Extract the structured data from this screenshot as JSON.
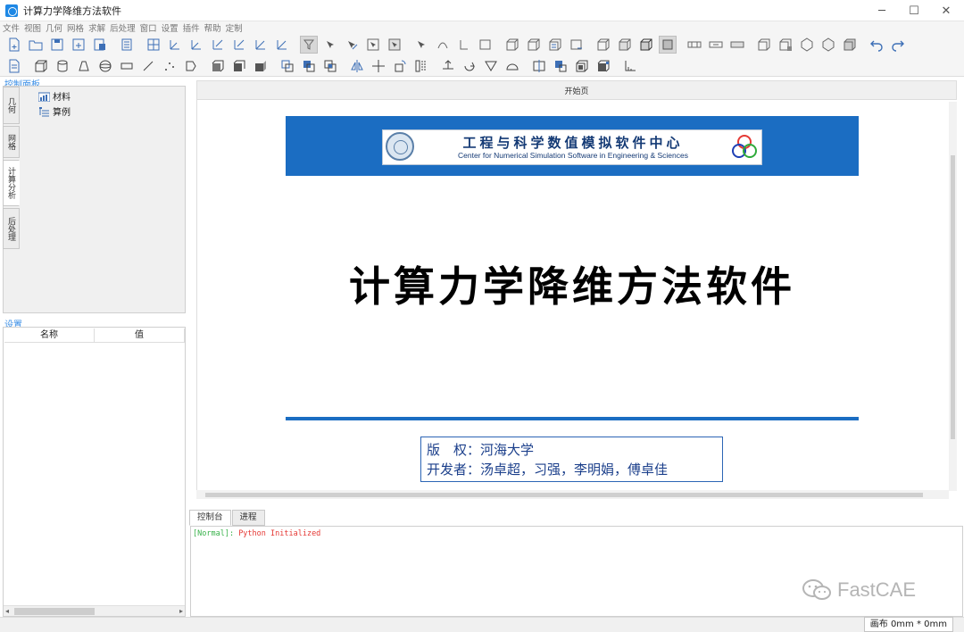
{
  "window": {
    "title": "计算力学降维方法软件",
    "minimize": "─",
    "maximize": "☐",
    "close": "✕"
  },
  "menu": [
    "文件",
    "视图",
    "几何",
    "网格",
    "求解",
    "后处理",
    "窗口",
    "设置",
    "插件",
    "帮助",
    "定制"
  ],
  "control_panel": {
    "label": "控制面板",
    "vertical_tabs": [
      "几何",
      "网格",
      "计算分析",
      "后处理"
    ],
    "active_tab": "计算分析",
    "tree": [
      "材料",
      "算例"
    ]
  },
  "settings": {
    "label": "设置",
    "columns": [
      "名称",
      "值"
    ]
  },
  "central": {
    "tab_label": "开始页",
    "center_name_cn": "工程与科学数值模拟软件中心",
    "center_name_en": "Center for Numerical Simulation Software in Engineering & Sciences",
    "main_title": "计算力学降维方法软件",
    "copyright_line": "版　权：河海大学",
    "developers_line": "开发者：汤卓超，习强，李明娟，傅卓佳"
  },
  "console": {
    "tabs": [
      "控制台",
      "进程"
    ],
    "active_tab": "控制台",
    "log_level": "[Normal]:",
    "log_message": "Python Initialized"
  },
  "watermark": "FastCAE",
  "status": {
    "canvas_size": "画布 0mm * 0mm"
  },
  "colors": {
    "accent_blue": "#1b6dc2",
    "panel_label": "#3a8ee6",
    "log_level": "#38b24a",
    "log_message": "#e53935"
  }
}
